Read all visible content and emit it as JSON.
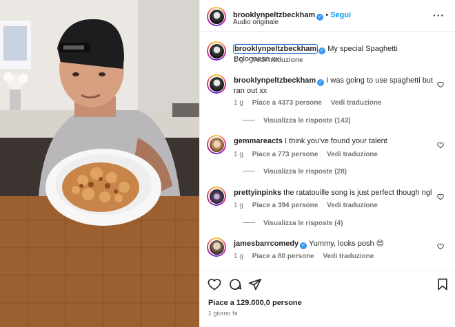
{
  "post": {
    "username": "brooklynpeltzbeckham",
    "follow_label": "Segui",
    "audio_label": "Audio originale",
    "more_icon": "more-horizontal-icon"
  },
  "caption": {
    "username": "brooklynpeltzbeckham",
    "text": "My special Spaghetti Bolognese xx",
    "age": "1 g",
    "translate": "Vedi traduzione"
  },
  "comments": [
    {
      "username": "brooklynpeltzbeckham",
      "verified": true,
      "text": "I was going to use spaghetti but ran out xx",
      "age": "1 g",
      "likes": "Piace a 4373 persone",
      "translate": "Vedi traduzione",
      "replies": "Visualizza le risposte (143)"
    },
    {
      "username": "gemmareacts",
      "verified": false,
      "text": "I think you've found your talent",
      "age": "1 g",
      "likes": "Piace a 773 persone",
      "translate": "Vedi traduzione",
      "replies": "Visualizza le risposte (28)"
    },
    {
      "username": "prettyinpinks",
      "verified": false,
      "text": "the ratatouille song is just perfect though ngl",
      "age": "1 g",
      "likes": "Piace a 394 persone",
      "translate": "Vedi traduzione",
      "replies": "Visualizza le risposte (4)"
    },
    {
      "username": "jamesbarrcomedy",
      "verified": true,
      "text": "Yummy, looks posh 😍",
      "age": "1 g",
      "likes": "Piace a 80 persone",
      "translate": "Vedi traduzione"
    }
  ],
  "footer": {
    "likes": "Piace a 129.000,0 persone",
    "time": "1 giorno fa"
  },
  "colors": {
    "link_blue": "#0095f6",
    "verified_blue": "#3897f0",
    "muted": "#737373"
  }
}
